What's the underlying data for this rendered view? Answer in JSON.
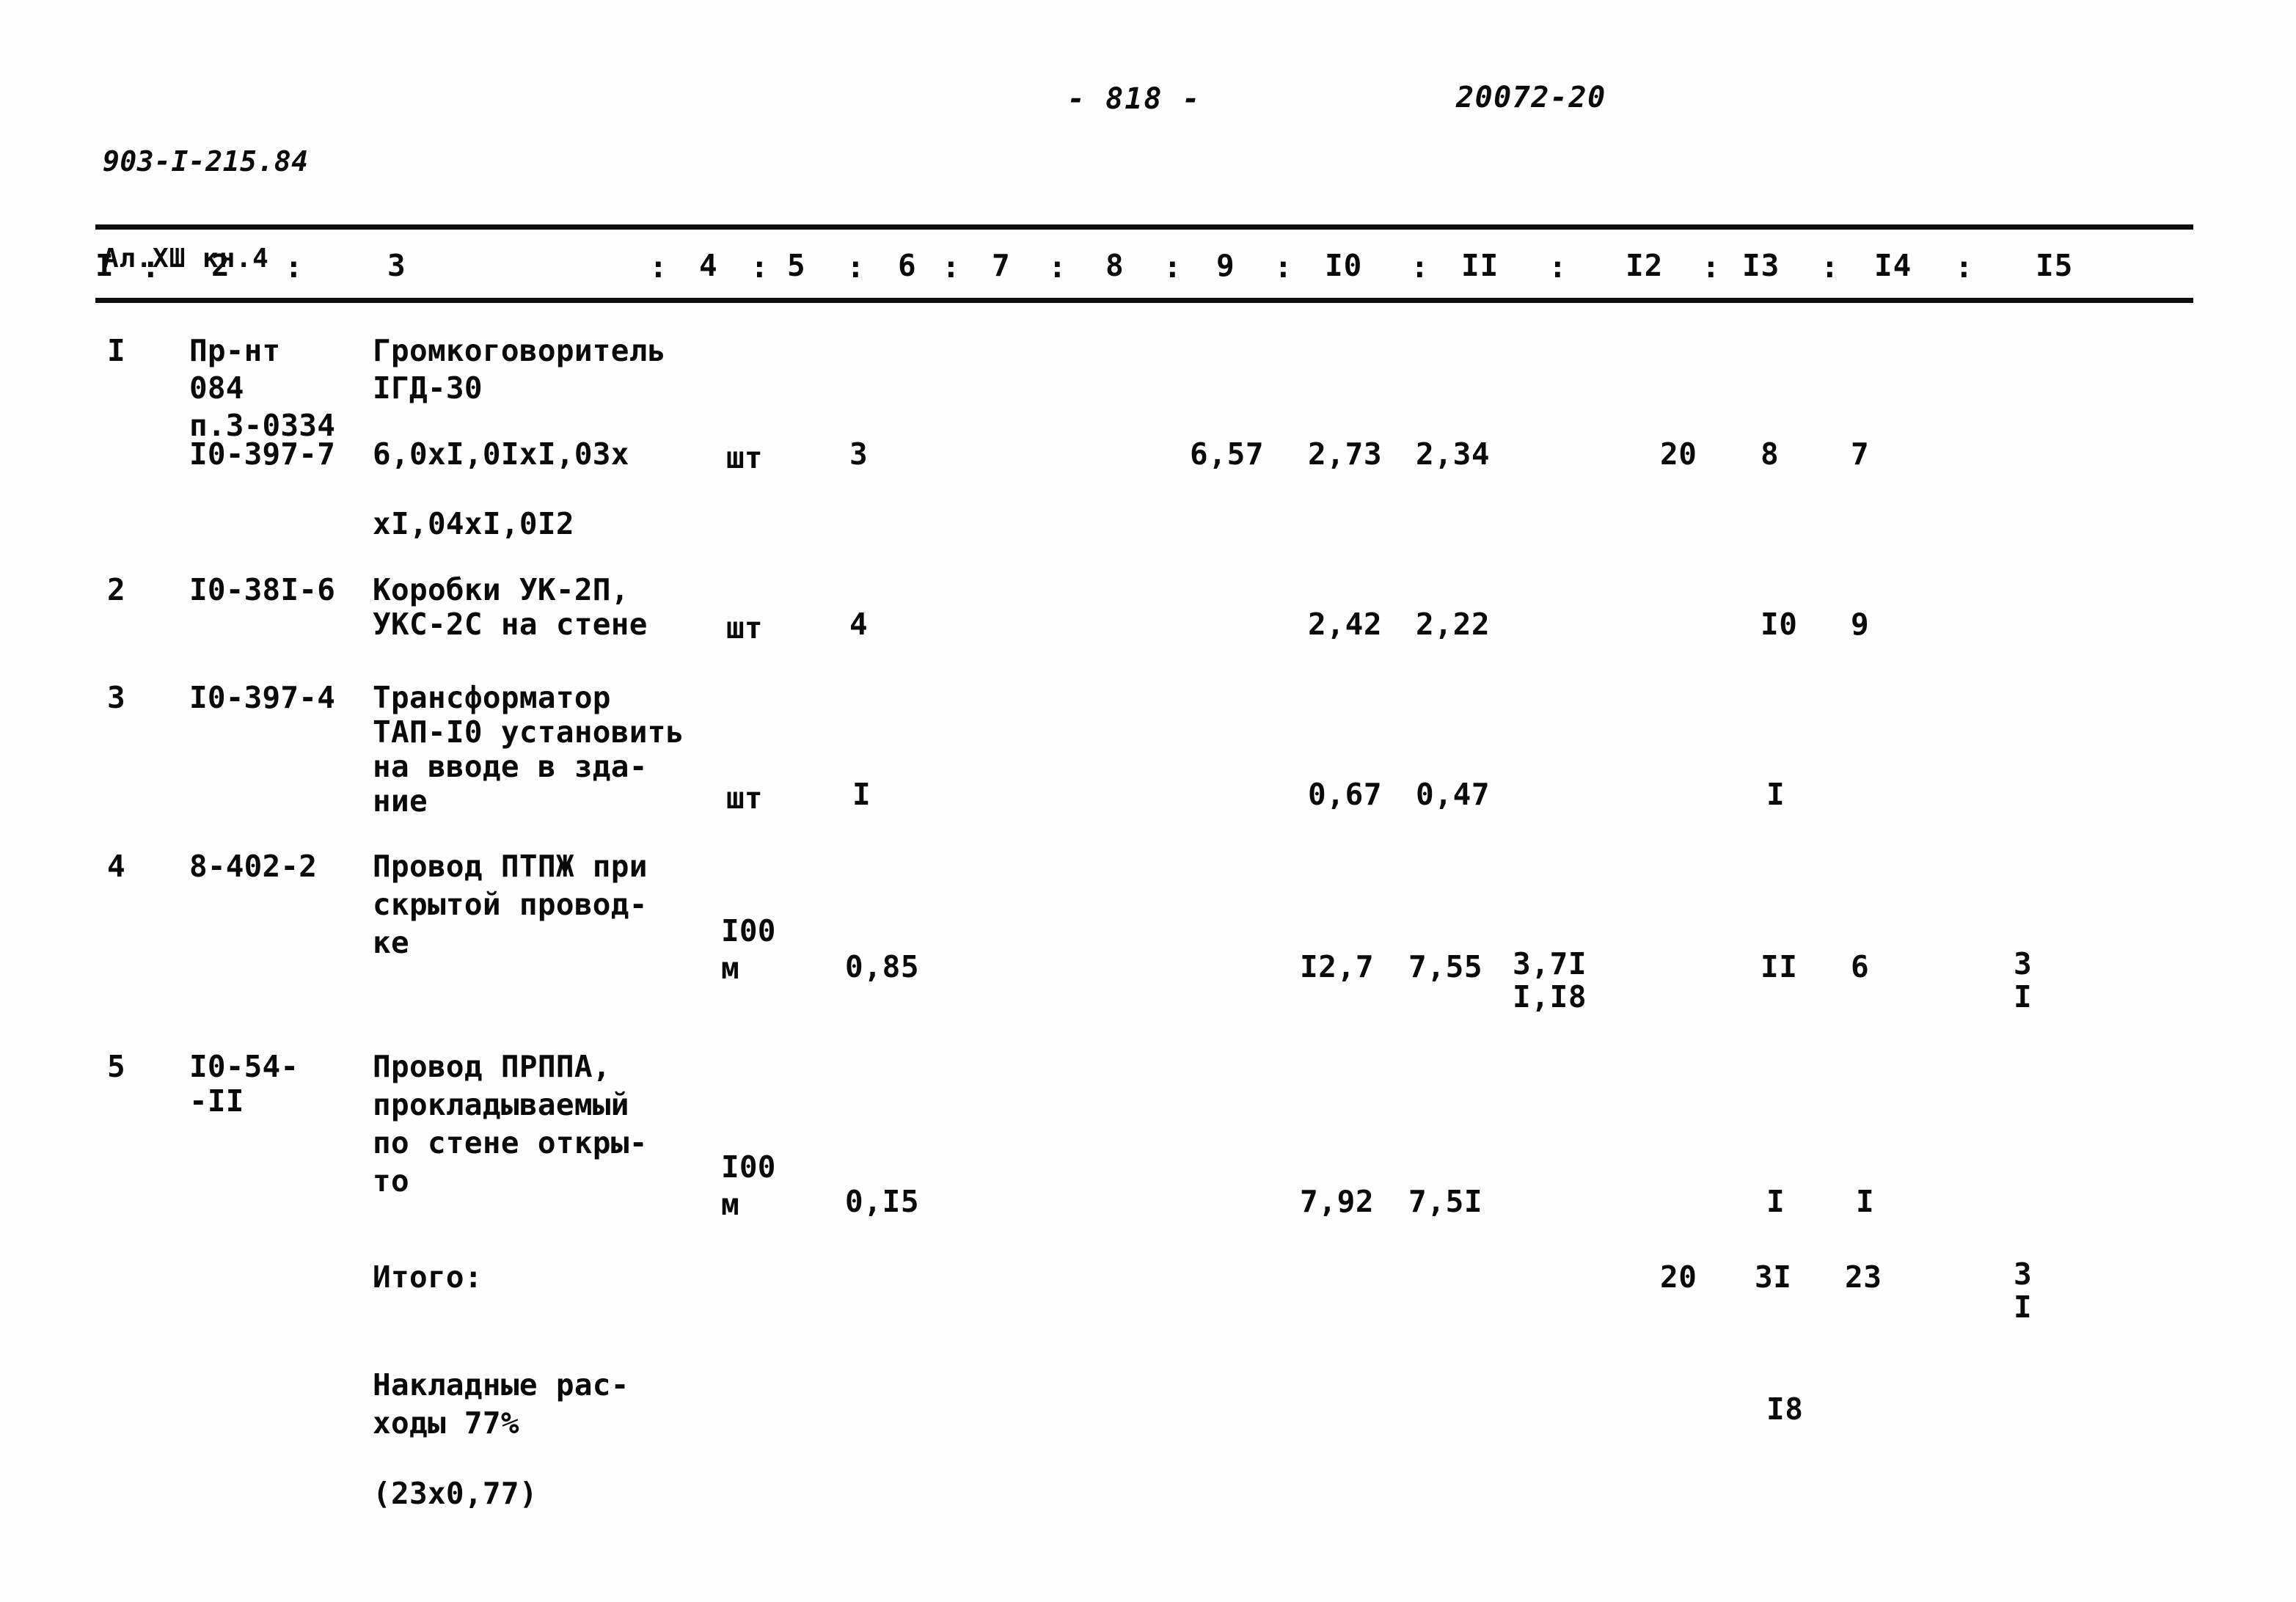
{
  "header": {
    "doc_code": "903-I-215.84",
    "album": "Ал.ХШ кн.4",
    "page_number": "- 818 -",
    "stamp": "20072-20"
  },
  "table": {
    "column_numbers": [
      "I",
      "2",
      "3",
      "4",
      "5",
      "6",
      "7",
      "8",
      "9",
      "I0",
      "II",
      "I2",
      "I3",
      "I4",
      "I5"
    ],
    "separator": ":",
    "rows": [
      {
        "pos": "I",
        "code_lines": [
          "Пр-нт",
          "084",
          "п.3-0334",
          "I0-397-7"
        ],
        "desc_lines": [
          "Громкоговоритель",
          "IГД-30",
          "6,0xI,0IxI,03x"
        ],
        "desc_cont": "xI,04xI,0I2",
        "unit": "шт",
        "c5": "3",
        "c8": "6,57",
        "c9": "2,73",
        "c10": "2,34",
        "c12": "20",
        "c13": "8",
        "c14": "7"
      },
      {
        "pos": "2",
        "code_lines": [
          "I0-38I-6"
        ],
        "desc_lines": [
          "Коробки УК-2П,",
          "УКС-2С на стене"
        ],
        "unit": "шт",
        "c5": "4",
        "c9": "2,42",
        "c10": "2,22",
        "c13": "I0",
        "c14": "9"
      },
      {
        "pos": "3",
        "code_lines": [
          "I0-397-4"
        ],
        "desc_lines": [
          "Трансформатор",
          "ТАП-I0 установить",
          "на вводе в зда-",
          "ние"
        ],
        "unit": "шт",
        "c5": "I",
        "c9": "0,67",
        "c10": "0,47",
        "c13": "I"
      },
      {
        "pos": "4",
        "code_lines": [
          "8-402-2"
        ],
        "desc_lines": [
          "Провод ПТПЖ при",
          "скрытой провод-",
          "ке"
        ],
        "unit_top": "I00",
        "unit_bot": "м",
        "c5": "0,85",
        "c9": "I2,7",
        "c10": "7,55",
        "c11_top": "3,7I",
        "c11_bot": "I,I8",
        "c13": "II",
        "c14": "6",
        "c15_top": "3",
        "c15_bot": "I"
      },
      {
        "pos": "5",
        "code_lines": [
          "I0-54-",
          "-II"
        ],
        "desc_lines": [
          "Провод ПРППА,",
          "прокладываемый",
          "по стене откры-",
          "то"
        ],
        "unit_top": "I00",
        "unit_bot": "м",
        "c5": "0,I5",
        "c9": "7,92",
        "c10": "7,5I",
        "c13": "I",
        "c14": "I"
      }
    ],
    "total_row": {
      "label": "Итого:",
      "c12": "20",
      "c13": "3I",
      "c14": "23",
      "c15_top": "3",
      "c15_bot": "I"
    },
    "overhead_row": {
      "label_lines": [
        "Накладные рас-",
        "ходы 77%"
      ],
      "formula": "(23x0,77)",
      "c13": "I8"
    }
  }
}
